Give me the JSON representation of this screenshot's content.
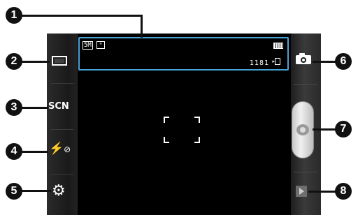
{
  "indicators": {
    "resolution_badge": "5M",
    "mode_badge": "°",
    "remaining_shots": "1181"
  },
  "controls": {
    "scene_label": "SCN",
    "flash_symbol": "⚡",
    "flash_off_symbol": "⊘",
    "settings_symbol": "⚙"
  },
  "callouts": [
    "1",
    "2",
    "3",
    "4",
    "5",
    "6",
    "7",
    "8"
  ],
  "colors": {
    "indicator_border": "#4aa3d8",
    "screen": "#000000",
    "callout": "#111111"
  },
  "icons": {
    "shooting_mode": "shooting-mode-icon",
    "scene": "scene-mode-icon",
    "flash": "flash-off-icon",
    "settings": "gear-icon",
    "camera_switch": "camera-switch-icon",
    "shutter": "shutter-icon",
    "gallery": "play-icon"
  }
}
